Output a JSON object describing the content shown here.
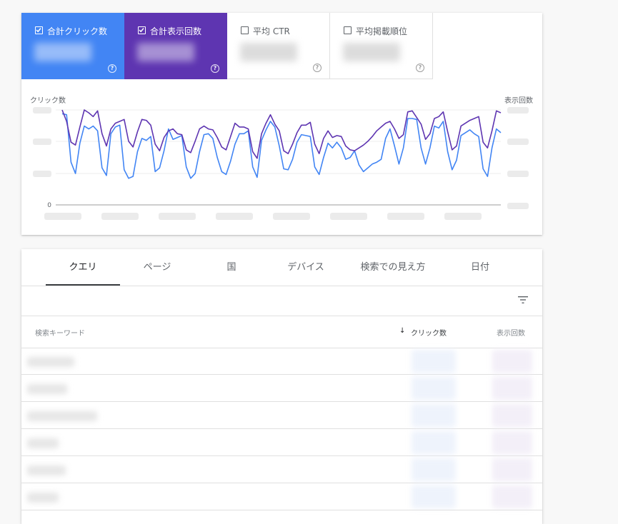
{
  "metrics": [
    {
      "label": "合計クリック数",
      "checked": true,
      "color": "#4285f4"
    },
    {
      "label": "合計表示回数",
      "checked": true,
      "color": "#5e35b1"
    },
    {
      "label": "平均 CTR",
      "checked": false
    },
    {
      "label": "平均掲載順位",
      "checked": false
    }
  ],
  "help_glyph": "?",
  "chart": {
    "left_axis_title": "クリック数",
    "right_axis_title": "表示回数",
    "zero_label": "0"
  },
  "chart_data": {
    "type": "line",
    "xlabel": "",
    "ylabel": "クリック数",
    "y2label": "表示回数",
    "grid": true,
    "series": [
      {
        "name": "合計クリック数",
        "color": "#4285f4",
        "axis": "left",
        "values": [
          96,
          95,
          45,
          33,
          65,
          83,
          80,
          83,
          78,
          39,
          31,
          75,
          82,
          84,
          37,
          28,
          30,
          56,
          70,
          68,
          72,
          35,
          39,
          57,
          80,
          69,
          71,
          73,
          40,
          28,
          33,
          56,
          74,
          75,
          70,
          50,
          35,
          32,
          46,
          64,
          75,
          75,
          78,
          40,
          29,
          68,
          79,
          88,
          82,
          62,
          38,
          37,
          48,
          66,
          74,
          73,
          72,
          40,
          32,
          50,
          65,
          60,
          66,
          60,
          48,
          50,
          57,
          42,
          35,
          39,
          43,
          45,
          48,
          70,
          80,
          62,
          43,
          60,
          91,
          91,
          90,
          60,
          43,
          60,
          83,
          81,
          88,
          56,
          37,
          47,
          73,
          76,
          79,
          75,
          72,
          38,
          30,
          60,
          80,
          76
        ]
      },
      {
        "name": "合計表示回数",
        "color": "#5e35b1",
        "axis": "right",
        "values": [
          100,
          88,
          66,
          63,
          82,
          100,
          97,
          93,
          99,
          75,
          62,
          80,
          86,
          88,
          90,
          67,
          61,
          77,
          90,
          89,
          84,
          64,
          57,
          71,
          78,
          80,
          75,
          74,
          58,
          55,
          67,
          80,
          83,
          80,
          79,
          71,
          61,
          58,
          72,
          86,
          82,
          82,
          80,
          56,
          49,
          75,
          86,
          95,
          85,
          78,
          57,
          54,
          64,
          76,
          84,
          84,
          87,
          64,
          54,
          70,
          78,
          71,
          73,
          72,
          62,
          58,
          57,
          60,
          63,
          67,
          72,
          78,
          82,
          86,
          88,
          80,
          70,
          74,
          98,
          99,
          92,
          85,
          69,
          75,
          91,
          93,
          98,
          77,
          58,
          62,
          83,
          86,
          89,
          91,
          93,
          66,
          60,
          78,
          99,
          97
        ]
      }
    ]
  },
  "tabs": [
    "クエリ",
    "ページ",
    "国",
    "デバイス",
    "検索での見え方",
    "日付"
  ],
  "active_tab": "クエリ",
  "table": {
    "col_query": "検索キーワード",
    "sort_arrow": "↓",
    "col_clicks": "クリック数",
    "col_impressions": "表示回数"
  }
}
